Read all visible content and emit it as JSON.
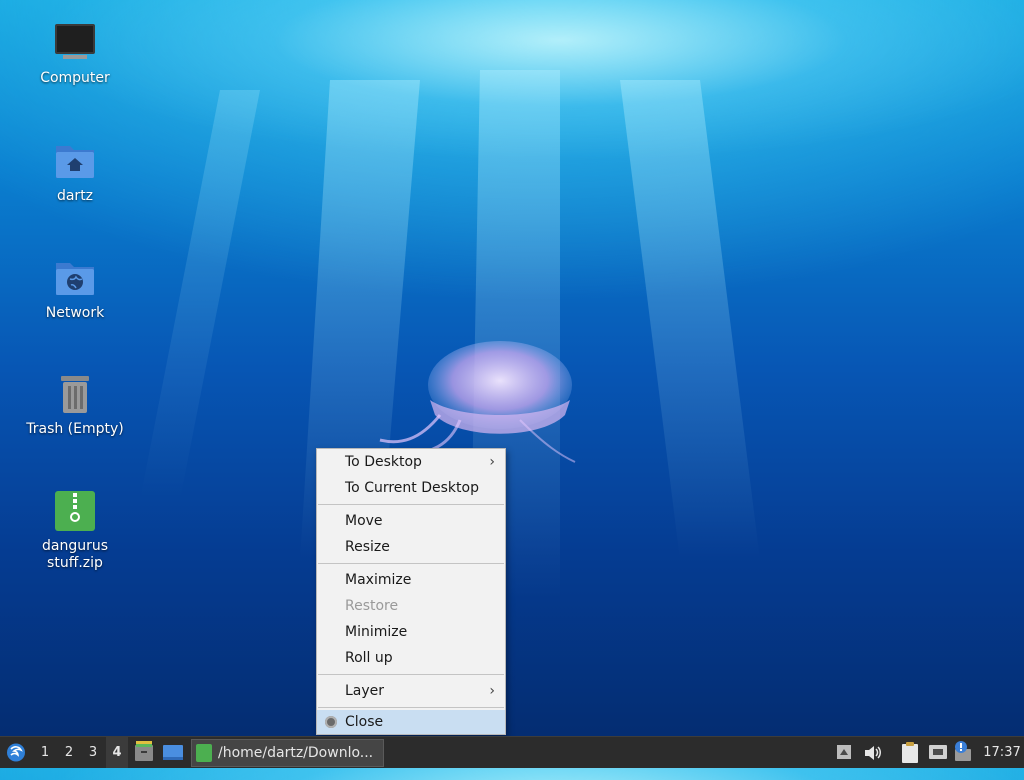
{
  "desktop": {
    "icons": [
      {
        "label": "Computer"
      },
      {
        "label": "dartz"
      },
      {
        "label": "Network"
      },
      {
        "label": "Trash (Empty)"
      },
      {
        "label": "dangurus stuff.zip"
      }
    ]
  },
  "menu": {
    "items": [
      {
        "label": "To Desktop"
      },
      {
        "label": "To Current Desktop"
      },
      {
        "label": "Move"
      },
      {
        "label": "Resize"
      },
      {
        "label": "Maximize"
      },
      {
        "label": "Restore"
      },
      {
        "label": "Minimize"
      },
      {
        "label": "Roll up"
      },
      {
        "label": "Layer"
      },
      {
        "label": "Close"
      }
    ],
    "submenu_arrow": "›"
  },
  "taskbar": {
    "workspaces": [
      "1",
      "2",
      "3",
      "4"
    ],
    "active_workspace": "4",
    "task_title": "/home/dartz/Downlo...",
    "clock": "17:37"
  },
  "colors": {
    "taskbar_bg": "#2c2c2c",
    "menu_bg": "#f2f2f2",
    "menu_highlight": "#c9def2",
    "zip_icon": "#4caf50",
    "folder_icon": "#4a8ee0"
  }
}
